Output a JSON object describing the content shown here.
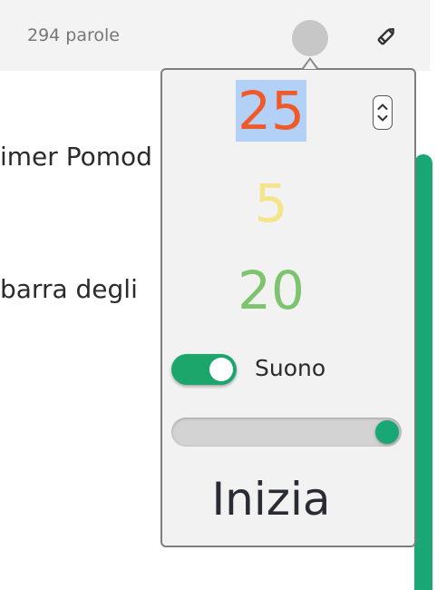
{
  "header": {
    "word_count": "294 parole"
  },
  "document": {
    "line1": "imer Pomod",
    "line2": "barra degli"
  },
  "pomodoro": {
    "work_minutes": "25",
    "short_break_minutes": "5",
    "long_break_minutes": "20",
    "sound_label": "Suono",
    "sound_enabled": true,
    "volume_fraction": 1.0,
    "start_label": "Inizia"
  },
  "colors": {
    "accent": "#1aa776",
    "work": "#f05a28",
    "short_break": "#f5e58a",
    "long_break": "#7ec46f"
  },
  "icons": {
    "timer": "timer-circle-icon",
    "edit": "pencil-icon",
    "stepper": "up-down-chevron-icon"
  }
}
